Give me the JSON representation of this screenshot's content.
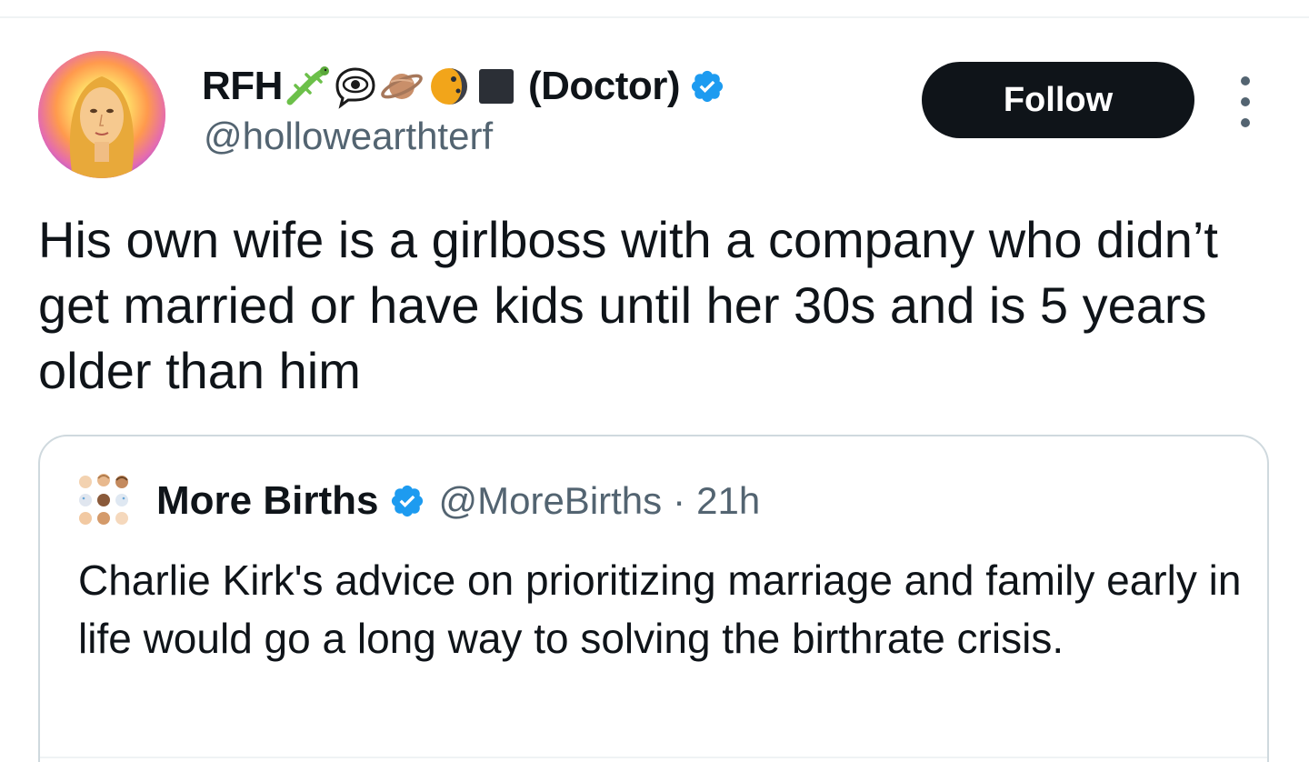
{
  "tweet": {
    "author": {
      "display_name": "RFH",
      "display_name_suffix": "(Doctor)",
      "emoji_icons": [
        "lizard-icon",
        "eye-in-speech-bubble-icon",
        "ringed-planet-icon",
        "moon-icon",
        "black-square-icon"
      ],
      "handle": "@hollowearthterf",
      "verified": true
    },
    "follow_label": "Follow",
    "text": "His own wife is a girlboss with a company who didn’t get married or have kids until her 30s and is 5 years older than him"
  },
  "quoted_tweet": {
    "author": {
      "display_name": "More Births",
      "handle": "@MoreBirths",
      "verified": true
    },
    "separator": "·",
    "time": "21h",
    "text": "Charlie Kirk's advice on prioritizing marriage and family early in life would go a long way to solving the birthrate crisis."
  },
  "colors": {
    "text_primary": "#0f1419",
    "text_secondary": "#536471",
    "verified_blue": "#1d9bf0",
    "border": "#cfd9de",
    "follow_bg": "#0f1419"
  }
}
